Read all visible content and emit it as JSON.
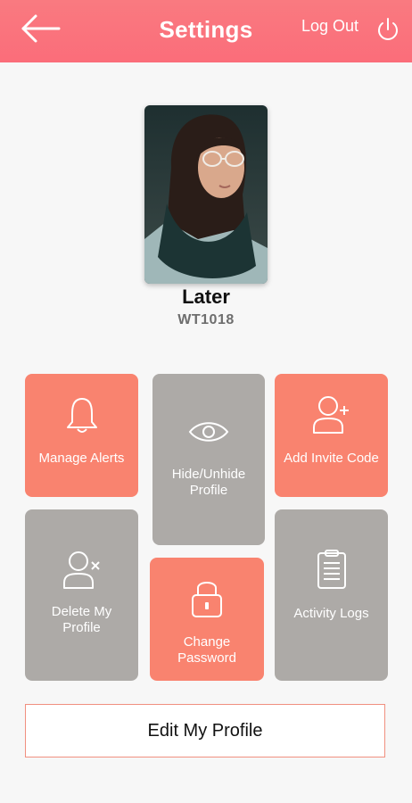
{
  "header": {
    "title": "Settings",
    "logout_label": "Log Out",
    "gradient_top": "#f97a80",
    "gradient_bottom": "#fb6d7a"
  },
  "profile": {
    "name": "Later",
    "code": "WT1018"
  },
  "tiles": [
    {
      "label": "Manage Alerts",
      "icon": "bell-icon",
      "color": "#f9836f"
    },
    {
      "label": "Hide/Unhide Profile",
      "icon": "eye-icon",
      "color": "#adaaa7"
    },
    {
      "label": "Add Invite Code",
      "icon": "add-user-icon",
      "color": "#f9836f"
    },
    {
      "label": "Delete My Profile",
      "icon": "remove-user-icon",
      "color": "#adaaa7"
    },
    {
      "label": "Change Password",
      "icon": "lock-icon",
      "color": "#f9836f"
    },
    {
      "label": "Activity Logs",
      "icon": "clipboard-icon",
      "color": "#adaaa7"
    }
  ],
  "edit_button_label": "Edit My Profile"
}
